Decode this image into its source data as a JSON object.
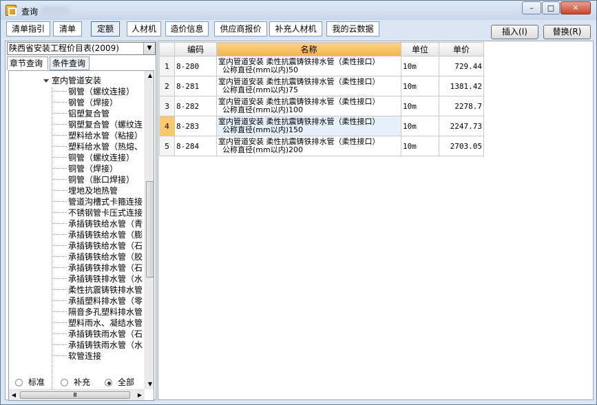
{
  "window": {
    "title": "查询"
  },
  "top_tabs": [
    "清单指引",
    "清单",
    "定额",
    "人材机",
    "造价信息",
    "供应商报价",
    "补充人材机",
    "我的云数据"
  ],
  "active_top_tab": "定额",
  "actions": {
    "insert": "插入(I)",
    "replace": "替换(R)"
  },
  "library_select": "陕西省安装工程价目表(2009)",
  "sub_tabs": [
    "章节查询",
    "条件查询"
  ],
  "tree": {
    "root": "室内管道安装",
    "items": [
      "钢管（螺纹连接）",
      "钢管（焊接）",
      "铝塑复合管",
      "钢塑复合管（螺纹连",
      "塑料给水管（粘接）",
      "塑料给水管（热熔、",
      "铜管（螺纹连接）",
      "铜管（焊接）",
      "铜管（胀口焊接）",
      "埋地及地热管",
      "管道沟槽式卡箍连接",
      "不锈钢管卡压式连接",
      "承插铸铁给水管（青",
      "承插铸铁给水管（膨",
      "承插铸铁给水管（石",
      "承插铸铁给水管（胶",
      "承插铸铁排水管（石",
      "承插铸铁排水管（水",
      "柔性抗震铸铁排水管",
      "承插塑料排水管（零",
      "隔音多孔塑料排水管",
      "塑料雨水、凝结水管",
      "承插铸铁雨水管（石",
      "承插铸铁雨水管（水",
      "软管连接"
    ]
  },
  "scroll_hint": "Ⅲ",
  "radio_options": [
    "标准",
    "补充",
    "全部"
  ],
  "radio_selected": "全部",
  "table": {
    "headers": [
      "",
      "编码",
      "名称",
      "单位",
      "单价"
    ],
    "rows": [
      {
        "no": "1",
        "code": "8-280",
        "name1": "室内管道安装 柔性抗震铸铁排水管（柔性接口）",
        "name2": "公称直径(mm以内)50",
        "unit": "10m",
        "price": "729.44"
      },
      {
        "no": "2",
        "code": "8-281",
        "name1": "室内管道安装 柔性抗震铸铁排水管（柔性接口）",
        "name2": "公称直径(mm以内)75",
        "unit": "10m",
        "price": "1381.42"
      },
      {
        "no": "3",
        "code": "8-282",
        "name1": "室内管道安装 柔性抗震铸铁排水管（柔性接口）",
        "name2": "公称直径(mm以内)100",
        "unit": "10m",
        "price": "2278.7"
      },
      {
        "no": "4",
        "code": "8-283",
        "name1": "室内管道安装 柔性抗震铸铁排水管（柔性接口）",
        "name2": "公称直径(mm以内)150",
        "unit": "10m",
        "price": "2247.73"
      },
      {
        "no": "5",
        "code": "8-284",
        "name1": "室内管道安装 柔性抗震铸铁排水管（柔性接口）",
        "name2": "公称直径(mm以内)200",
        "unit": "10m",
        "price": "2703.05"
      }
    ],
    "selected_row": "4"
  }
}
